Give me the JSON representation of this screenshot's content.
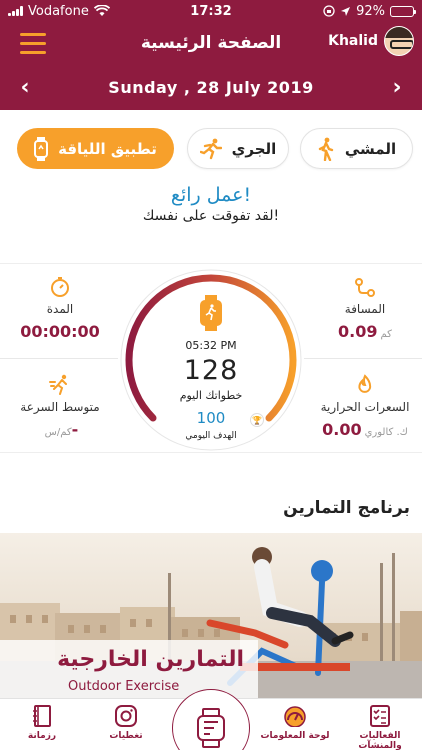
{
  "status_bar": {
    "carrier": "Vodafone",
    "time": "17:32",
    "battery_percent": "92%",
    "battery_level": 0.92
  },
  "header": {
    "title": "الصفحة الرئيسية",
    "user_name": "Khalid"
  },
  "date_bar": {
    "date": "Sunday , 28 July 2019",
    "prev_icon": "chevron-left-icon",
    "next_icon": "chevron-right-icon"
  },
  "activities": {
    "walking": "المشي",
    "running": "الجري",
    "fitness_app": "تطبيق اللياقة"
  },
  "praise": {
    "title": "عمل رائع!",
    "subtitle": "لقد تفوقت على نفسك!"
  },
  "stats": {
    "distance": {
      "label": "المسافة",
      "value": "0.09",
      "unit": "كم"
    },
    "duration": {
      "label": "المدة",
      "value": "00:00:00"
    },
    "calories": {
      "label": "السعرات الحرارية",
      "value": "0.00",
      "unit": "ك. كالوري"
    },
    "avg_speed": {
      "label": "متوسط السرعة",
      "value": "-",
      "unit": "كم/س"
    }
  },
  "progress": {
    "time": "05:32 PM",
    "steps": "128",
    "steps_label": "خطواتك اليوم",
    "goal": "100",
    "goal_label": "الهدف اليومي",
    "ring_fraction": 1.0
  },
  "program": {
    "title": "برنامج التمارين",
    "banner_ar": "التمارين الخارجية",
    "banner_en": "Outdoor Exercise"
  },
  "tabs": {
    "events": "الفعاليات والمنشآت",
    "dashboard": "لوحة المعلومات",
    "coverage": "تغطيات",
    "calendar": "رزمانة"
  },
  "colors": {
    "brand": "#8e1b3f",
    "accent": "#f7a02b",
    "link": "#1f8bc4"
  }
}
